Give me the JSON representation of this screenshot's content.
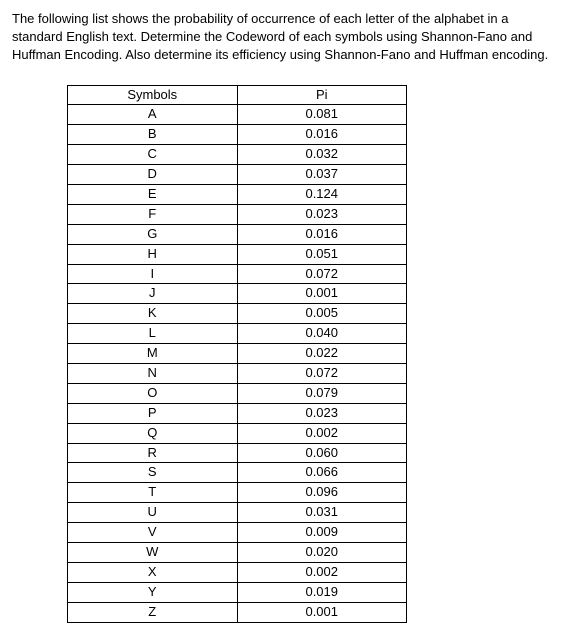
{
  "problem_text": "The following list shows the probability of occurrence of each letter of the alphabet in a standard English text. Determine the Codeword of each symbols using Shannon-Fano and Huffman Encoding. Also determine its efficiency using Shannon-Fano and Huffman encoding.",
  "table": {
    "headers": {
      "col1": "Symbols",
      "col2": "Pi"
    },
    "rows": [
      {
        "symbol": "A",
        "pi": "0.081"
      },
      {
        "symbol": "B",
        "pi": "0.016"
      },
      {
        "symbol": "C",
        "pi": "0.032"
      },
      {
        "symbol": "D",
        "pi": "0.037"
      },
      {
        "symbol": "E",
        "pi": "0.124"
      },
      {
        "symbol": "F",
        "pi": "0.023"
      },
      {
        "symbol": "G",
        "pi": "0.016"
      },
      {
        "symbol": "H",
        "pi": "0.051"
      },
      {
        "symbol": "I",
        "pi": "0.072"
      },
      {
        "symbol": "J",
        "pi": "0.001"
      },
      {
        "symbol": "K",
        "pi": "0.005"
      },
      {
        "symbol": "L",
        "pi": "0.040"
      },
      {
        "symbol": "M",
        "pi": "0.022"
      },
      {
        "symbol": "N",
        "pi": "0.072"
      },
      {
        "symbol": "O",
        "pi": "0.079"
      },
      {
        "symbol": "P",
        "pi": "0.023"
      },
      {
        "symbol": "Q",
        "pi": "0.002"
      },
      {
        "symbol": "R",
        "pi": "0.060"
      },
      {
        "symbol": "S",
        "pi": "0.066"
      },
      {
        "symbol": "T",
        "pi": "0.096"
      },
      {
        "symbol": "U",
        "pi": "0.031"
      },
      {
        "symbol": "V",
        "pi": "0.009"
      },
      {
        "symbol": "W",
        "pi": "0.020"
      },
      {
        "symbol": "X",
        "pi": "0.002"
      },
      {
        "symbol": "Y",
        "pi": "0.019"
      },
      {
        "symbol": "Z",
        "pi": "0.001"
      }
    ]
  },
  "chart_data": {
    "type": "table",
    "title": "Probability of occurrence of each letter of the alphabet in a standard English text",
    "columns": [
      "Symbols",
      "Pi"
    ],
    "rows": [
      [
        "A",
        0.081
      ],
      [
        "B",
        0.016
      ],
      [
        "C",
        0.032
      ],
      [
        "D",
        0.037
      ],
      [
        "E",
        0.124
      ],
      [
        "F",
        0.023
      ],
      [
        "G",
        0.016
      ],
      [
        "H",
        0.051
      ],
      [
        "I",
        0.072
      ],
      [
        "J",
        0.001
      ],
      [
        "K",
        0.005
      ],
      [
        "L",
        0.04
      ],
      [
        "M",
        0.022
      ],
      [
        "N",
        0.072
      ],
      [
        "O",
        0.079
      ],
      [
        "P",
        0.023
      ],
      [
        "Q",
        0.002
      ],
      [
        "R",
        0.06
      ],
      [
        "S",
        0.066
      ],
      [
        "T",
        0.096
      ],
      [
        "U",
        0.031
      ],
      [
        "V",
        0.009
      ],
      [
        "W",
        0.02
      ],
      [
        "X",
        0.002
      ],
      [
        "Y",
        0.019
      ],
      [
        "Z",
        0.001
      ]
    ]
  }
}
